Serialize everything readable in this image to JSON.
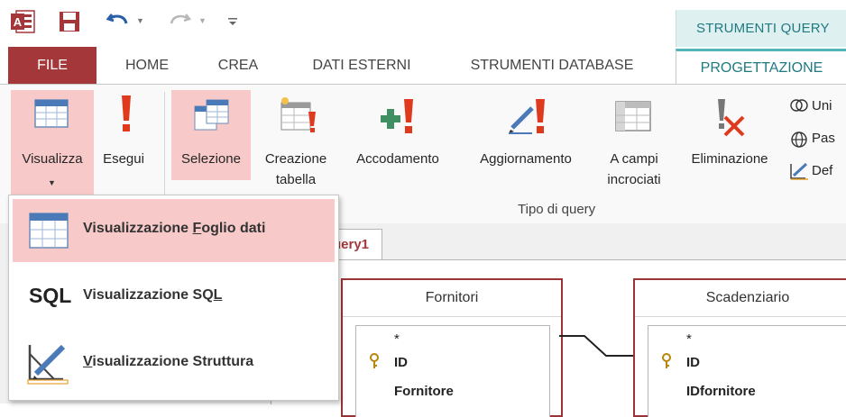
{
  "quick_access": {
    "app_icon": "access-icon",
    "context_title": "STRUMENTI QUERY"
  },
  "tabs": [
    {
      "label": "FILE"
    },
    {
      "label": "HOME"
    },
    {
      "label": "CREA"
    },
    {
      "label": "DATI ESTERNI"
    },
    {
      "label": "STRUMENTI DATABASE"
    },
    {
      "label": "PROGETTAZIONE"
    }
  ],
  "ribbon": {
    "view_button": "Visualizza",
    "run_button": "Esegui",
    "query_types": {
      "select": "Selezione",
      "make_table_1": "Creazione",
      "make_table_2": "tabella",
      "append": "Accodamento",
      "update": "Aggiornamento",
      "crosstab_1": "A campi",
      "crosstab_2": "incrociati",
      "delete": "Eliminazione"
    },
    "group_label": "Tipo di query",
    "side_items": [
      "Uni",
      "Pas",
      "Def"
    ]
  },
  "document": {
    "tab_label": "uery1"
  },
  "tables": [
    {
      "name": "Fornitori",
      "fields": [
        "*",
        "ID",
        "Fornitore"
      ]
    },
    {
      "name": "Scadenziario",
      "fields": [
        "*",
        "ID",
        "IDfornitore"
      ]
    }
  ],
  "dropdown": {
    "items": [
      {
        "icon": "datasheet-view-icon",
        "pre": "Visualizzazione ",
        "accel": "F",
        "post": "oglio dati",
        "selected": true
      },
      {
        "icon": "sql-icon",
        "icon_text": "SQL",
        "pre": "Visualizzazione SQ",
        "accel": "L",
        "post": "",
        "selected": false
      },
      {
        "icon": "design-view-icon",
        "pre": "",
        "accel": "V",
        "post": "isualizzazione Struttura",
        "selected": false
      }
    ]
  },
  "colors": {
    "access_red": "#a4373a",
    "highlight": "#f7c9c9",
    "teal": "#207a82"
  }
}
